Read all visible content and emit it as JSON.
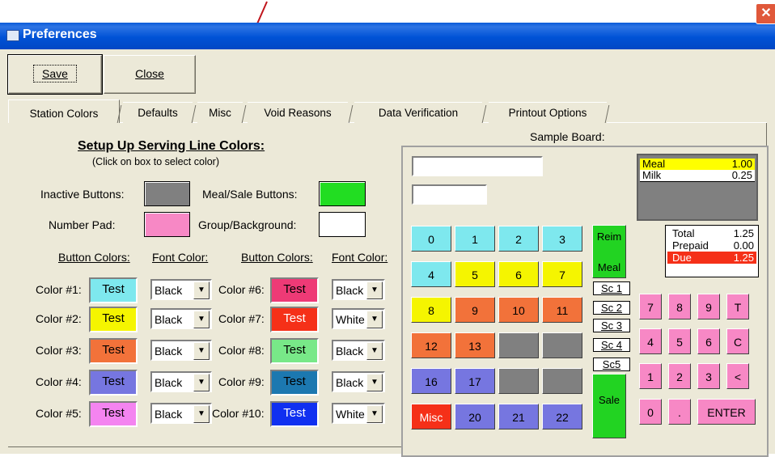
{
  "window": {
    "title": "Preferences",
    "close_glyph": "✕"
  },
  "toolbar": {
    "save_label": "Save",
    "close_label": "Close"
  },
  "tabs": [
    {
      "label": "Station Colors",
      "active": true
    },
    {
      "label": "Defaults"
    },
    {
      "label": "Misc"
    },
    {
      "label": "Void Reasons"
    },
    {
      "label": "Data Verification"
    },
    {
      "label": "Printout Options"
    }
  ],
  "setup": {
    "heading": "Setup Up Serving Line Colors:",
    "subheading": "(Click on box to select color)",
    "inactive_label": "Inactive Buttons:",
    "meal_sale_label": "Meal/Sale Buttons:",
    "number_pad_label": "Number Pad:",
    "group_bg_label": "Group/Background:",
    "inactive_color": "#808080",
    "meal_sale_color": "#22dd22",
    "number_pad_color": "#f788c5",
    "group_bg_color": "#ffffff"
  },
  "columns": {
    "button_colors": "Button Colors:",
    "font_color": "Font Color:"
  },
  "colors_left": [
    {
      "label": "Color #1:",
      "test": "Test",
      "bg": "#7ee8ee",
      "fg": "#000000",
      "font": "Black"
    },
    {
      "label": "Color #2:",
      "test": "Test",
      "bg": "#f5f500",
      "fg": "#000000",
      "font": "Black"
    },
    {
      "label": "Color #3:",
      "test": "Test",
      "bg": "#f2723a",
      "fg": "#000000",
      "font": "Black"
    },
    {
      "label": "Color #4:",
      "test": "Test",
      "bg": "#7676e0",
      "fg": "#000000",
      "font": "Black"
    },
    {
      "label": "Color #5:",
      "test": "Test",
      "bg": "#f484f0",
      "fg": "#000000",
      "font": "Black"
    }
  ],
  "colors_right": [
    {
      "label": "Color #6:",
      "test": "Test",
      "bg": "#ee3a76",
      "fg": "#000000",
      "font": "Black"
    },
    {
      "label": "Color #7:",
      "test": "Test",
      "bg": "#f53018",
      "fg": "#ffffff",
      "font": "White"
    },
    {
      "label": "Color #8:",
      "test": "Test",
      "bg": "#78e888",
      "fg": "#000000",
      "font": "Black"
    },
    {
      "label": "Color #9:",
      "test": "Test",
      "bg": "#1c78b0",
      "fg": "#000000",
      "font": "Black"
    },
    {
      "label": "Color #10:",
      "test": "Test",
      "bg": "#1030f0",
      "fg": "#ffffff",
      "font": "White"
    }
  ],
  "sample": {
    "title": "Sample Board:",
    "receipt": [
      {
        "name": "Meal",
        "value": "1.00",
        "bg": "#ffff00",
        "fg": "#000000"
      },
      {
        "name": "Milk",
        "value": "0.25",
        "bg": "#ffffff",
        "fg": "#000000"
      }
    ],
    "totals": [
      {
        "name": "Total",
        "value": "1.25",
        "bg": "#ffffff",
        "fg": "#000000"
      },
      {
        "name": "Prepaid",
        "value": "0.00",
        "bg": "#ffffff",
        "fg": "#000000"
      },
      {
        "name": "Due",
        "value": "1.25",
        "bg": "#f53018",
        "fg": "#ffffff"
      }
    ],
    "keys": [
      {
        "label": "0",
        "bg": "#7ee8ee"
      },
      {
        "label": "1",
        "bg": "#7ee8ee"
      },
      {
        "label": "2",
        "bg": "#7ee8ee"
      },
      {
        "label": "3",
        "bg": "#7ee8ee"
      },
      {
        "label": "4",
        "bg": "#7ee8ee"
      },
      {
        "label": "5",
        "bg": "#f5f500"
      },
      {
        "label": "6",
        "bg": "#f5f500"
      },
      {
        "label": "7",
        "bg": "#f5f500"
      },
      {
        "label": "8",
        "bg": "#f5f500"
      },
      {
        "label": "9",
        "bg": "#f2723a"
      },
      {
        "label": "10",
        "bg": "#f2723a"
      },
      {
        "label": "11",
        "bg": "#f2723a"
      },
      {
        "label": "12",
        "bg": "#f2723a"
      },
      {
        "label": "13",
        "bg": "#f2723a"
      },
      {
        "label": "",
        "bg": "#808080"
      },
      {
        "label": "",
        "bg": "#808080"
      },
      {
        "label": "16",
        "bg": "#7676e0"
      },
      {
        "label": "17",
        "bg": "#7676e0"
      },
      {
        "label": "",
        "bg": "#808080"
      },
      {
        "label": "",
        "bg": "#808080"
      },
      {
        "label": "Misc",
        "bg": "#f53018",
        "fg": "#ffffff"
      },
      {
        "label": "20",
        "bg": "#7676e0"
      },
      {
        "label": "21",
        "bg": "#7676e0"
      },
      {
        "label": "22",
        "bg": "#7676e0"
      }
    ],
    "reim_label": "Reim",
    "meal_label": "Meal",
    "sale_label": "Sale",
    "sc_buttons": [
      "Sc 1",
      "Sc 2",
      "Sc 3",
      "Sc 4",
      "Sc5"
    ],
    "numpad": [
      "7",
      "8",
      "9",
      "T",
      "4",
      "5",
      "6",
      "C",
      "1",
      "2",
      "3",
      "<"
    ],
    "numpad_zero": "0",
    "numpad_dot": ".",
    "enter_label": "ENTER"
  }
}
